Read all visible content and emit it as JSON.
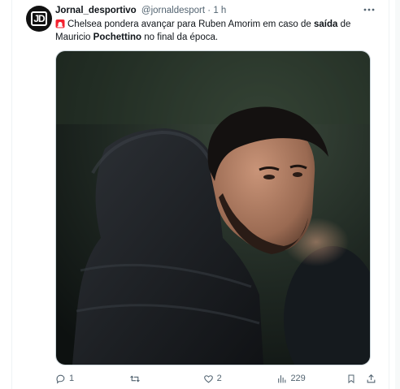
{
  "tweet": {
    "author_name": "Jornal_desportivo",
    "author_handle": "@jornaldesport",
    "separator": "·",
    "time": "1 h",
    "text_parts": {
      "p1": "Chelsea pondera avançar para Ruben Amorim em caso de ",
      "b1": "saída",
      "p2": " de Mauricio ",
      "b2": "Pochettino",
      "p3": " no final da época."
    },
    "avatar_logo": "JD",
    "emoji_icon": "rotating-light-icon"
  },
  "actions": {
    "reply_count": "1",
    "retweet_count": "",
    "like_count": "2",
    "views_count": "229"
  },
  "colors": {
    "text_primary": "#0f1419",
    "text_secondary": "#536471",
    "border": "#cfd9de"
  }
}
